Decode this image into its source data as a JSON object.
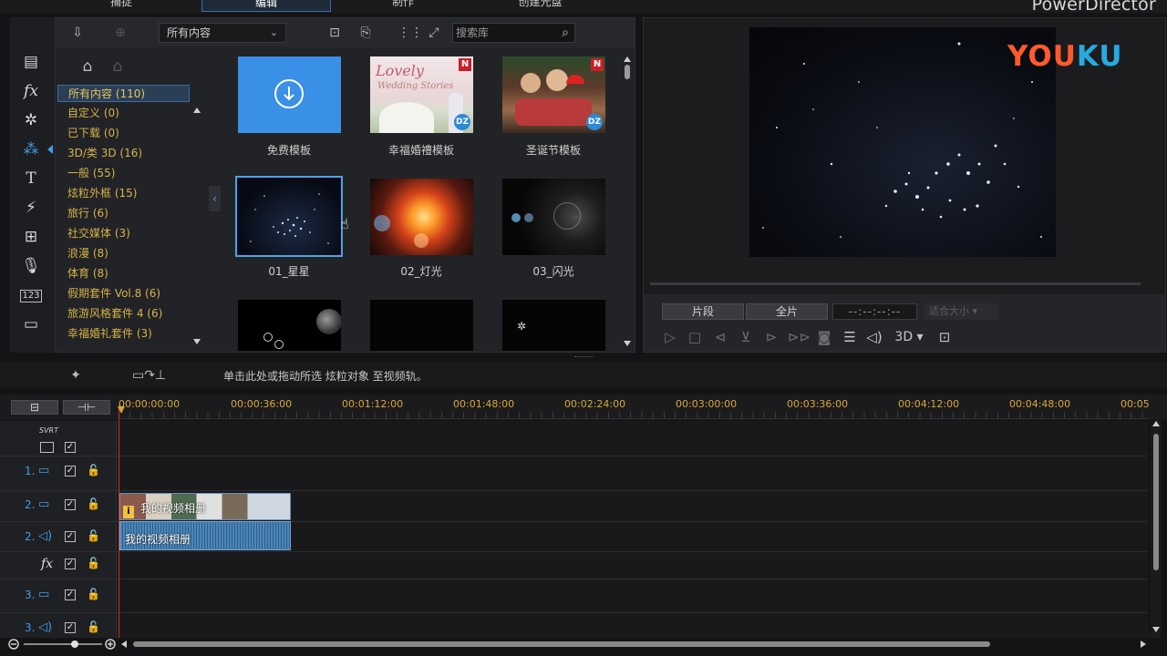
{
  "app": {
    "brand": "PowerDirector",
    "tabs": [
      "捕捉",
      "编辑",
      "制作",
      "创建光盘"
    ],
    "active_tab": "编辑"
  },
  "library": {
    "filter_selected": "所有内容",
    "search_placeholder": "搜索库",
    "categories": [
      "所有内容 (110)",
      "自定义  (0)",
      "已下载  (0)",
      "3D/类 3D  (16)",
      "一般  (55)",
      "炫粒外框  (15)",
      "旅行  (6)",
      "社交媒体  (3)",
      "浪漫  (8)",
      "体育  (8)",
      "假期套件 Vol.8  (6)",
      "旅游风格套件 4  (6)",
      "幸福婚礼套件  (3)"
    ],
    "selected_category": "所有内容 (110)",
    "items": [
      {
        "label": "免费模板"
      },
      {
        "label": "幸福婚禮模板",
        "badge": "N",
        "thumb_text_1": "Lovely",
        "thumb_text_2": "Wedding Stories"
      },
      {
        "label": "圣诞节模板",
        "badge": "N"
      },
      {
        "label": "01_星星",
        "selected": true
      },
      {
        "label": "02_灯光"
      },
      {
        "label": "03_闪光"
      },
      {
        "label": ""
      },
      {
        "label": ""
      },
      {
        "label": ""
      }
    ],
    "dz_badge": "DZ"
  },
  "preview": {
    "watermark_you": "YOU",
    "watermark_ku": "KU",
    "clip_button": "片段",
    "full_button": "全片",
    "timecode": "--:--:--:--",
    "fit_label": "适合大小",
    "mode_3d": "3D"
  },
  "action_hint": "单击此处或拖动所选 炫粒对象 至视频轨。",
  "timeline": {
    "ticks": [
      "00:00:00:00",
      "00:00:36:00",
      "00:01:12:00",
      "00:01:48:00",
      "00:02:24:00",
      "00:03:00:00",
      "00:03:36:00",
      "00:04:12:00",
      "00:04:48:00",
      "00:05"
    ],
    "svrt_label": "SVRT",
    "tracks": [
      {
        "num": "1.",
        "type": "video"
      },
      {
        "num": "2.",
        "type": "video"
      },
      {
        "num": "2.",
        "type": "audio"
      },
      {
        "num": "",
        "type": "fx"
      },
      {
        "num": "3.",
        "type": "video"
      },
      {
        "num": "3.",
        "type": "audio"
      }
    ],
    "clip_video_label": "我的视频相册",
    "clip_audio_label": "我的视频相册"
  },
  "colors": {
    "accent": "#3f9de8",
    "category_text": "#d6b34a",
    "tick_text": "#d6a83a",
    "playhead": "#c4312d"
  }
}
